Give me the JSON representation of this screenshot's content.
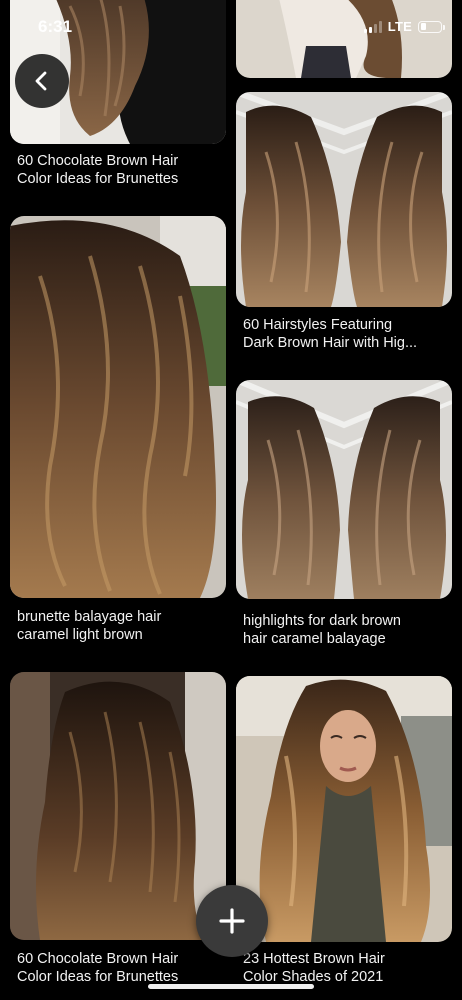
{
  "status_bar": {
    "time": "6:31",
    "network": "LTE"
  },
  "pins": [
    {
      "title_line1": "60 Chocolate Brown Hair",
      "title_line2": "Color Ideas for Brunettes"
    },
    {
      "title_line1": "60 Hairstyles Featuring",
      "title_line2": "Dark Brown Hair with Hig..."
    },
    {
      "title_line1": "brunette balayage hair",
      "title_line2": "caramel light brown"
    },
    {
      "title_line1": "highlights for dark brown",
      "title_line2": "hair caramel balayage"
    },
    {
      "title_line1": "60 Chocolate Brown Hair",
      "title_line2": "Color Ideas for Brunettes"
    },
    {
      "title_line1": "23 Hottest Brown Hair",
      "title_line2": "Color Shades of 2021"
    }
  ],
  "icons": {
    "back": "chevron-left-icon",
    "add": "plus-icon"
  },
  "colors": {
    "background": "#000000",
    "button_dark": "#3a3a3a"
  }
}
